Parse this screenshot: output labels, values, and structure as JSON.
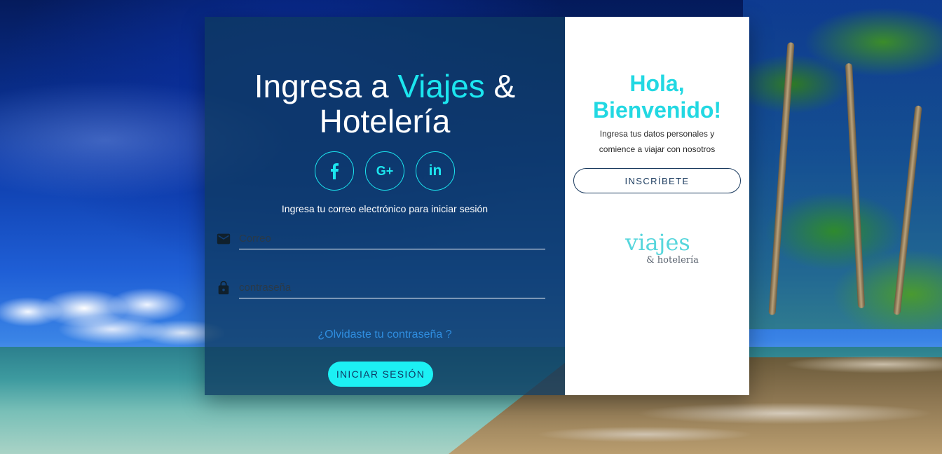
{
  "login": {
    "title_prefix": "Ingresa a ",
    "title_brand": "Viajes",
    "title_suffix": " & Hotelería",
    "social": [
      {
        "label": "f",
        "icon": "facebook-icon"
      },
      {
        "label": "G+",
        "icon": "google-plus-icon"
      },
      {
        "label": "in",
        "icon": "linkedin-icon"
      }
    ],
    "subtitle": "Ingresa tu correo electrónico para iniciar sesión",
    "email_placeholder": "Correo",
    "password_placeholder": "contraseña",
    "forgot": "¿Olvidaste tu contraseña ?",
    "submit": "INICIAR SESIÓN"
  },
  "welcome": {
    "title": "Hola, Bienvenido!",
    "subtitle": "Ingresa tus datos personales y comience a viajar con nosotros",
    "signup": "INSCRÍBETE",
    "logo_main": "viajes",
    "logo_sub": "& hotelería"
  },
  "colors": {
    "accent": "#1ce6ef",
    "panel": "#0e3a60",
    "link": "#2f8ee0",
    "dark": "#1a3a5e"
  }
}
